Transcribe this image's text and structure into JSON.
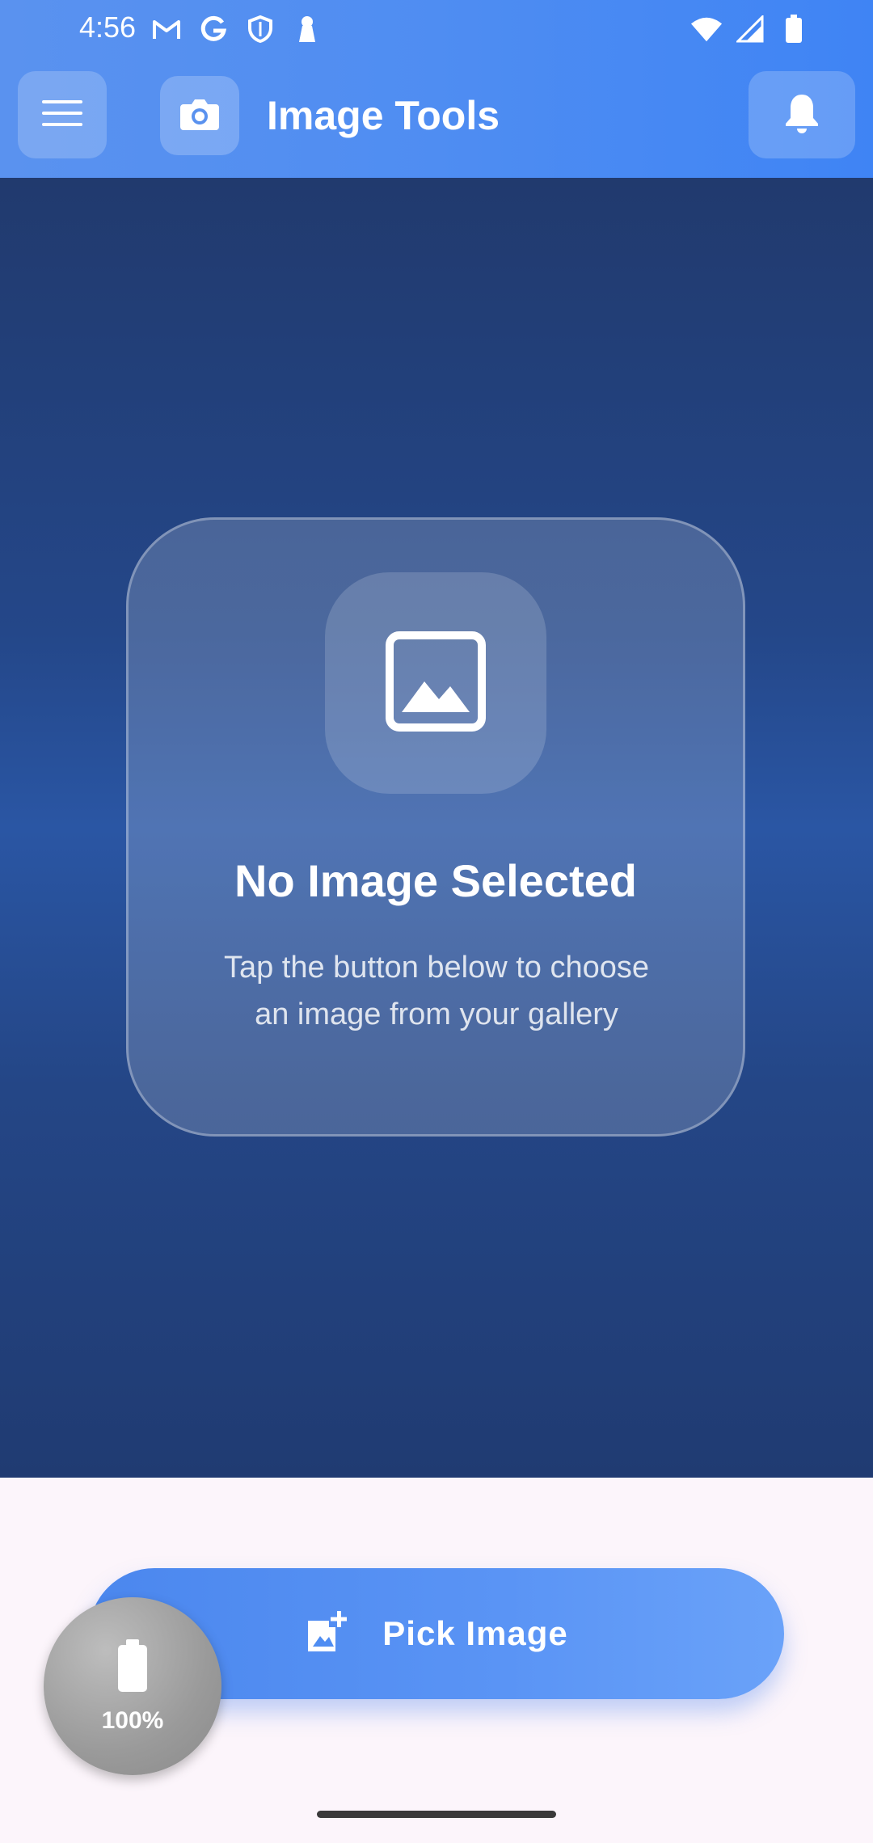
{
  "status_bar": {
    "time": "4:56",
    "left_icons": [
      "gmail-icon",
      "google-icon",
      "shield-icon",
      "keyhole-icon"
    ],
    "right_icons": [
      "wifi-icon",
      "cell-signal-icon",
      "battery-icon"
    ]
  },
  "app_bar": {
    "title": "Image Tools",
    "menu_icon": "menu-icon",
    "logo_icon": "camera-icon",
    "notifications_icon": "bell-icon"
  },
  "empty_state": {
    "icon": "image-icon",
    "title": "No Image Selected",
    "description": "Tap the button below to choose an image from your gallery"
  },
  "pick_button": {
    "label": "Pick Image",
    "icon": "add-photo-icon"
  },
  "battery_widget": {
    "percent": "100%",
    "icon": "battery-icon"
  },
  "colors": {
    "app_bar": "#4f8df2",
    "content_background": "#244789",
    "button": "#5a94f5",
    "page_background": "#fcf5fb"
  }
}
